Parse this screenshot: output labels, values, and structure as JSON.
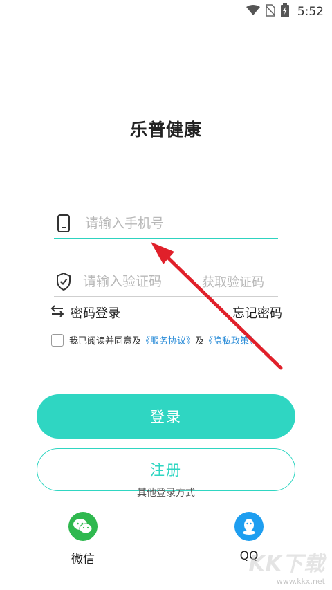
{
  "status_bar": {
    "time": "5:52",
    "icons": [
      "wifi-icon",
      "no-sim-icon",
      "battery-charging-icon"
    ]
  },
  "app": {
    "title": "乐普健康"
  },
  "phone_field": {
    "placeholder": "请输入手机号",
    "icon": "phone-icon"
  },
  "code_field": {
    "placeholder": "请输入验证码",
    "icon": "shield-check-icon",
    "get_code_label": "获取验证码"
  },
  "links": {
    "password_login": "密码登录",
    "forgot_password": "忘记密码"
  },
  "agreement": {
    "checked": false,
    "prefix": "我已阅读并同意及",
    "service_link": "《服务协议》",
    "and": "及",
    "privacy_link": "《隐私政策》"
  },
  "buttons": {
    "login": "登录",
    "register": "注册"
  },
  "other_login": {
    "label": "其他登录方式",
    "options": [
      {
        "label": "微信",
        "icon": "wechat-icon"
      },
      {
        "label": "QQ",
        "icon": "qq-icon"
      }
    ]
  },
  "watermark": {
    "logo": "KK下载",
    "url": "www.kkx.net"
  },
  "colors": {
    "accent": "#2fd6c2",
    "link": "#2a8cd8",
    "wechat": "#2fb84f",
    "qq": "#1e9ef0",
    "annotation_arrow": "#e0202a"
  }
}
